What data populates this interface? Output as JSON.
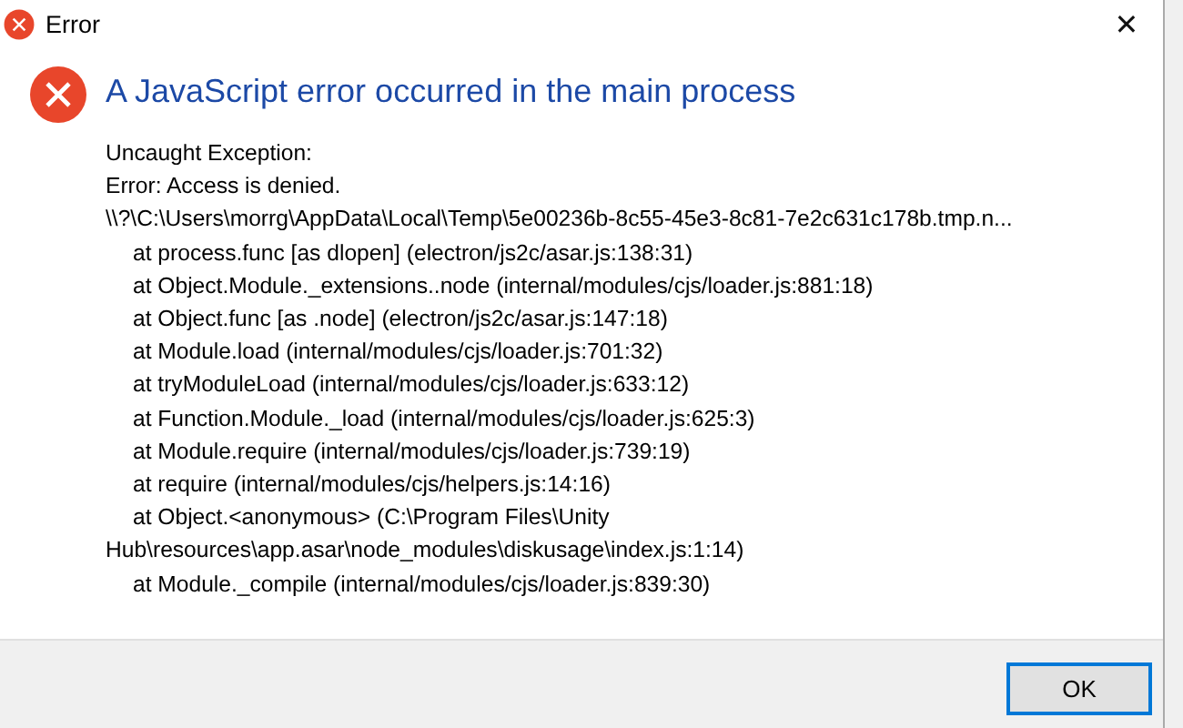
{
  "window": {
    "title": "Error",
    "close": "✕"
  },
  "heading": "A JavaScript error occurred in the main process",
  "message": [
    {
      "kind": "header",
      "text": "Uncaught Exception:"
    },
    {
      "kind": "header",
      "text": "Error: Access is denied."
    },
    {
      "kind": "header",
      "text": "\\\\?\\C:\\Users\\morrg\\AppData\\Local\\Temp\\5e00236b-8c55-45e3-8c81-7e2c631c178b.tmp.n..."
    },
    {
      "kind": "frame",
      "text": "at process.func [as dlopen] (electron/js2c/asar.js:138:31)"
    },
    {
      "kind": "frame",
      "text": "at Object.Module._extensions..node (internal/modules/cjs/loader.js:881:18)"
    },
    {
      "kind": "frame",
      "text": "at Object.func [as .node] (electron/js2c/asar.js:147:18)"
    },
    {
      "kind": "frame",
      "text": "at Module.load (internal/modules/cjs/loader.js:701:32)"
    },
    {
      "kind": "frame",
      "text": "at tryModuleLoad (internal/modules/cjs/loader.js:633:12)"
    },
    {
      "kind": "frame",
      "text": "at Function.Module._load (internal/modules/cjs/loader.js:625:3)"
    },
    {
      "kind": "frame",
      "text": "at Module.require (internal/modules/cjs/loader.js:739:19)"
    },
    {
      "kind": "frame",
      "text": "at require (internal/modules/cjs/helpers.js:14:16)"
    },
    {
      "kind": "frame",
      "text": "at Object.<anonymous> (C:\\Program Files\\Unity"
    },
    {
      "kind": "header",
      "text": "Hub\\resources\\app.asar\\node_modules\\diskusage\\index.js:1:14)"
    },
    {
      "kind": "frame",
      "text": "at Module._compile (internal/modules/cjs/loader.js:839:30)"
    }
  ],
  "buttons": [
    "OK"
  ]
}
